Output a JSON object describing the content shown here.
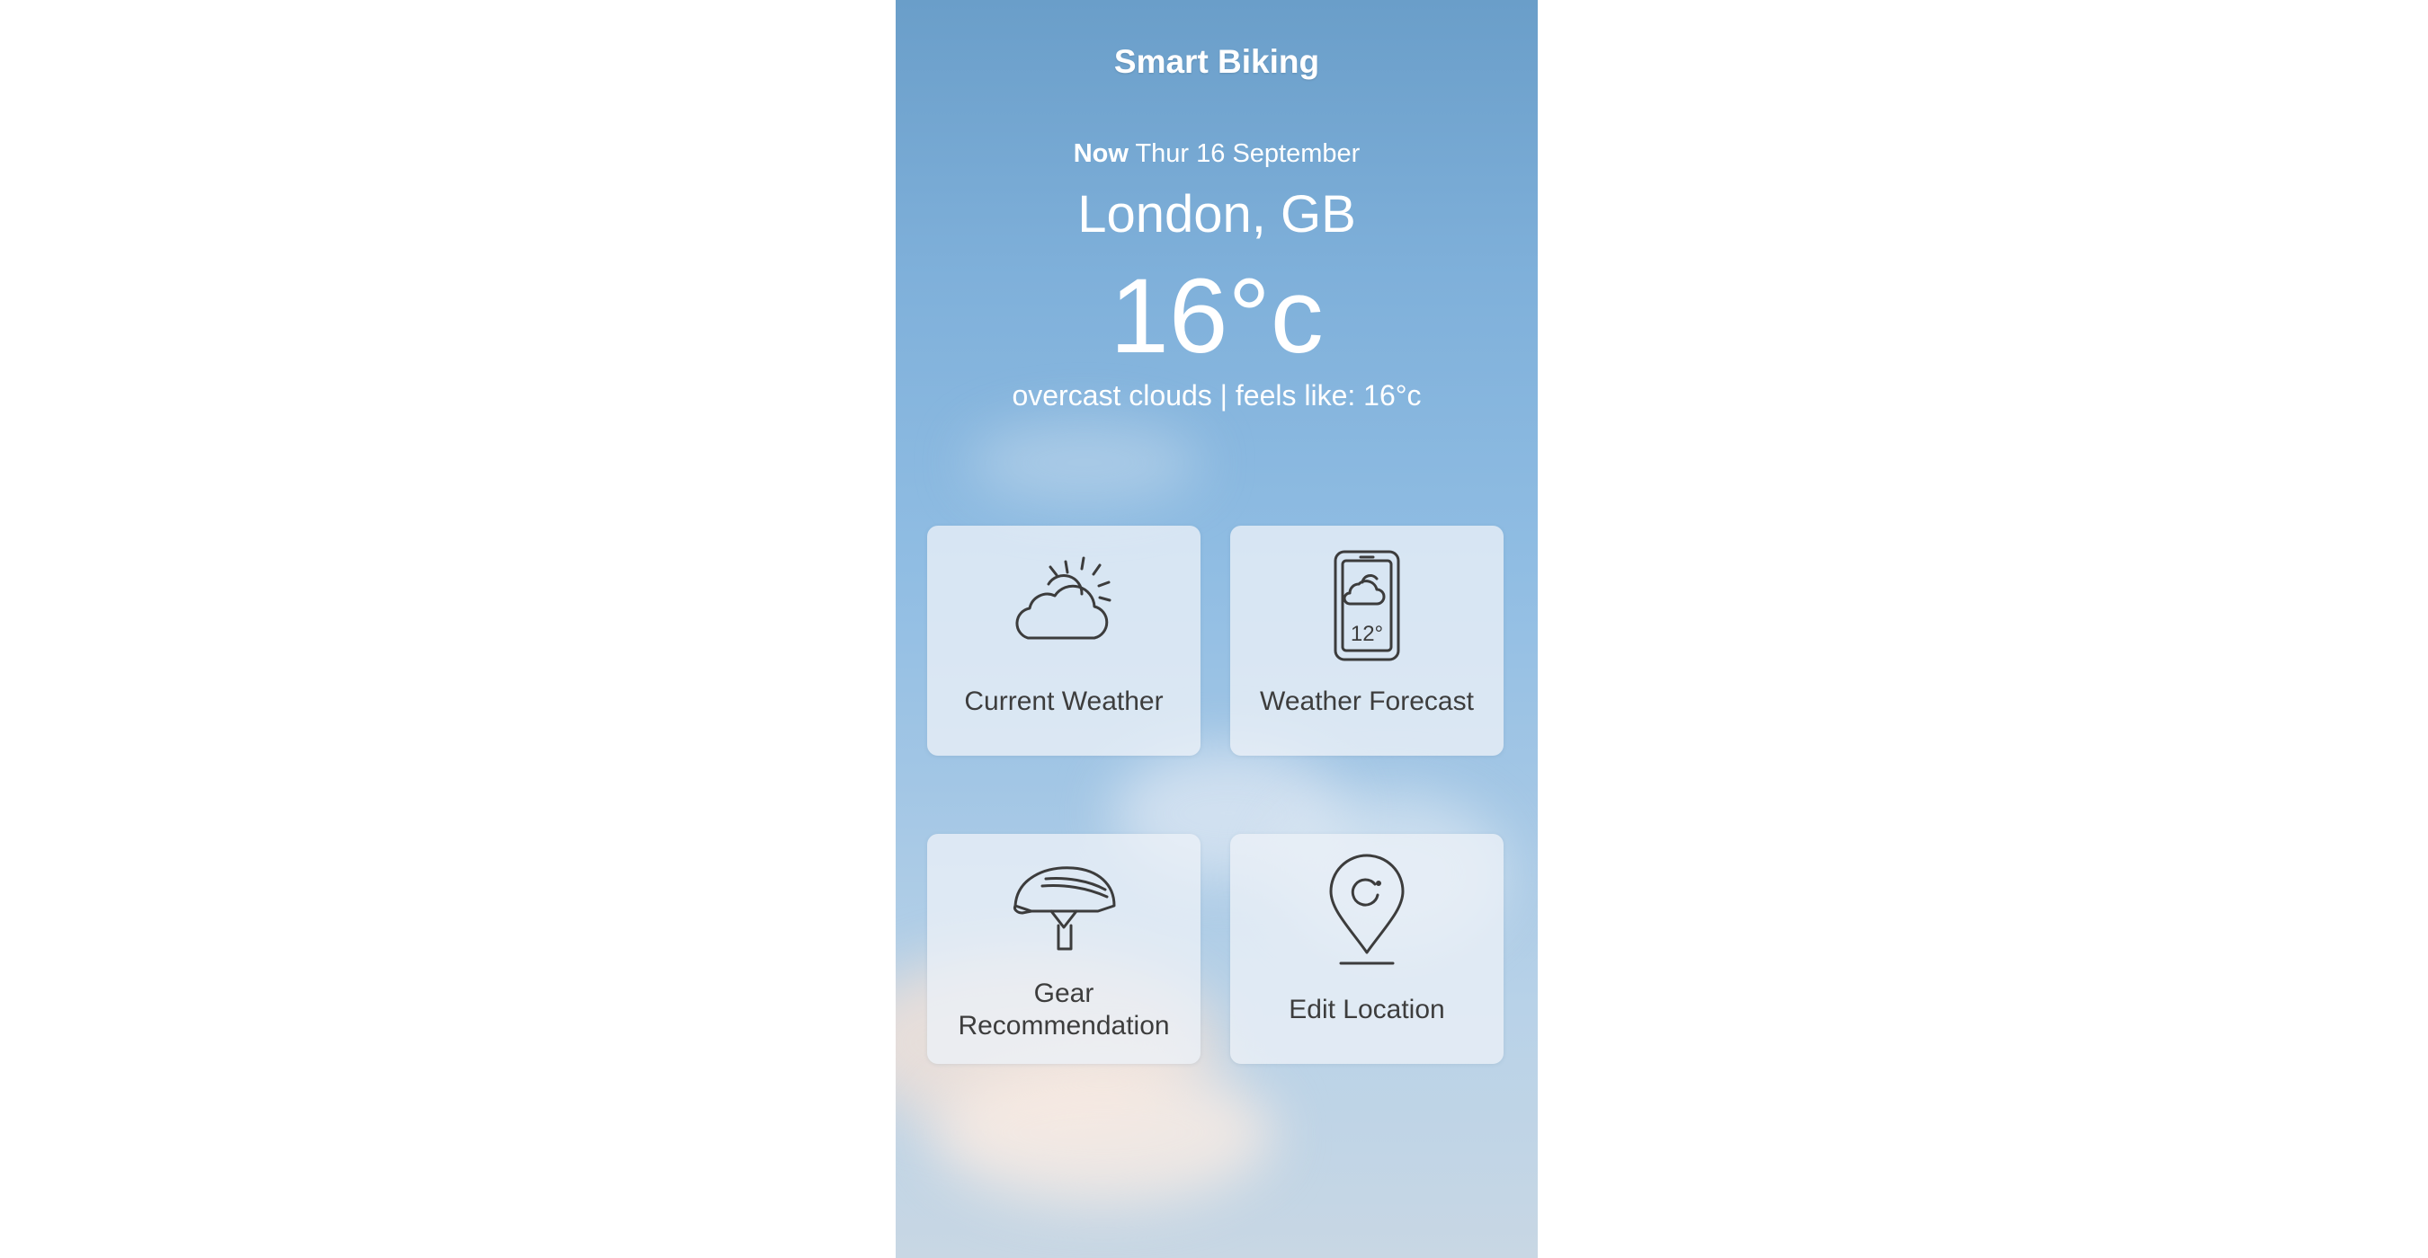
{
  "app": {
    "title": "Smart Biking"
  },
  "current": {
    "now_label": "Now",
    "date": "Thur 16 September",
    "location": "London, GB",
    "temperature": "16°c",
    "description": "overcast clouds | feels like: 16°c"
  },
  "tiles": [
    {
      "label": "Current Weather",
      "icon": "cloud-sun-icon"
    },
    {
      "label": "Weather Forecast",
      "icon": "phone-weather-icon",
      "icon_text": "12°"
    },
    {
      "label_line1": "Gear",
      "label_line2": "Recommendation",
      "icon": "helmet-icon"
    },
    {
      "label": "Edit Location",
      "icon": "location-pin-icon"
    }
  ],
  "colors": {
    "sky_top": "#6a9ec9",
    "sky_bottom": "#c8d7e4",
    "tile_background": "#ecf1f7",
    "tile_text": "#3d3d3d",
    "header_text": "#ffffff"
  }
}
